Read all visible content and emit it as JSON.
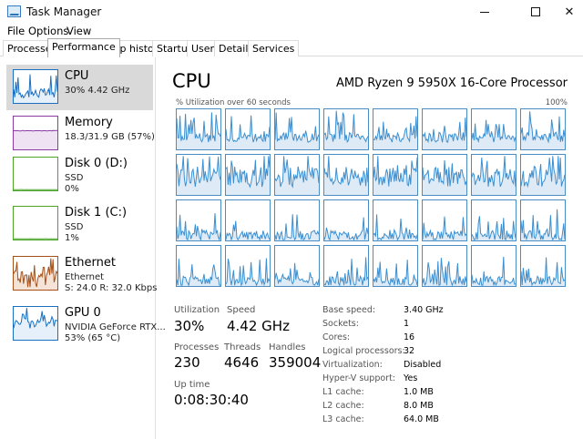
{
  "window": {
    "title": "Task Manager",
    "minimize": "",
    "maximize": "",
    "close": "✕"
  },
  "menu": [
    "File",
    "Options",
    "View"
  ],
  "tabs": [
    "Processes",
    "Performance",
    "App history",
    "Startup",
    "Users",
    "Details",
    "Services"
  ],
  "active_tab": "Performance",
  "sidebar": [
    {
      "title": "CPU",
      "sub1": "30%  4.42 GHz",
      "sub2": "",
      "color": "#1a6fbf",
      "fill": "#e6f0fa",
      "kind": "cpu",
      "selected": true
    },
    {
      "title": "Memory",
      "sub1": "18.3/31.9 GB (57%)",
      "sub2": "",
      "color": "#8b3aa6",
      "fill": "#efe3f3",
      "kind": "mem",
      "selected": false
    },
    {
      "title": "Disk 0 (D:)",
      "sub1": "SSD",
      "sub2": "0%",
      "color": "#4ca52a",
      "fill": "#ffffff",
      "kind": "flat",
      "selected": false
    },
    {
      "title": "Disk 1 (C:)",
      "sub1": "SSD",
      "sub2": "1%",
      "color": "#4ca52a",
      "fill": "#ffffff",
      "kind": "flat",
      "selected": false
    },
    {
      "title": "Ethernet",
      "sub1": "Ethernet",
      "sub2": "S: 24.0  R: 32.0 Kbps",
      "color": "#a6501a",
      "fill": "#f4e3d6",
      "kind": "eth",
      "selected": false
    },
    {
      "title": "GPU 0",
      "sub1": "NVIDIA GeForce RTX...",
      "sub2": "53%  (65 °C)",
      "color": "#1a6fbf",
      "fill": "#e6f0fa",
      "kind": "gpu",
      "selected": false
    }
  ],
  "main": {
    "heading": "CPU",
    "model": "AMD Ryzen 9 5950X 16-Core Processor",
    "util_label": "% Utilization over 60 seconds",
    "util_max": "100%",
    "line_color": "#3c8fd0",
    "fill_color": "#deebf7"
  },
  "stats": {
    "utilization_label": "Utilization",
    "utilization": "30%",
    "speed_label": "Speed",
    "speed": "4.42 GHz",
    "processes_label": "Processes",
    "processes": "230",
    "threads_label": "Threads",
    "threads": "4646",
    "handles_label": "Handles",
    "handles": "359004",
    "uptime_label": "Up time",
    "uptime": "0:08:30:40"
  },
  "specs": [
    {
      "label": "Base speed:",
      "value": "3.40 GHz"
    },
    {
      "label": "Sockets:",
      "value": "1"
    },
    {
      "label": "Cores:",
      "value": "16"
    },
    {
      "label": "Logical processors:",
      "value": "32"
    },
    {
      "label": "Virtualization:",
      "value": "Disabled"
    },
    {
      "label": "Hyper-V support:",
      "value": "Yes"
    },
    {
      "label": "L1 cache:",
      "value": "1.0 MB"
    },
    {
      "label": "L2 cache:",
      "value": "8.0 MB"
    },
    {
      "label": "L3 cache:",
      "value": "64.0 MB"
    }
  ]
}
